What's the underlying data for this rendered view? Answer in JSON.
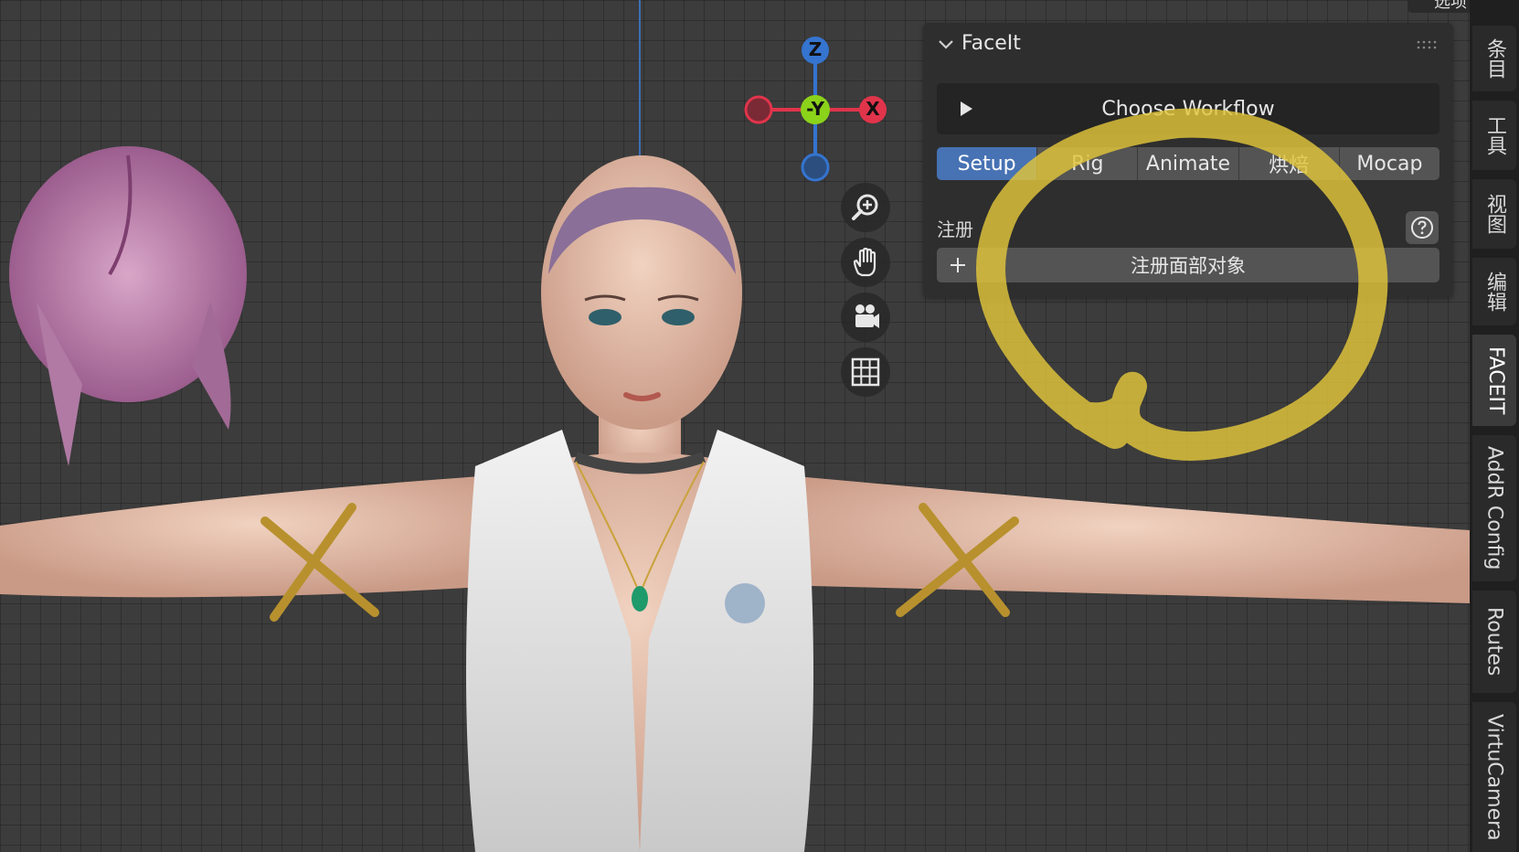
{
  "top_corner": {
    "label": "选项"
  },
  "panel": {
    "title": "FaceIt",
    "collapse_icon": "chevron-down-icon",
    "workflow_button": {
      "label": "Choose Workflow",
      "icon": "play-icon"
    },
    "tabs": [
      {
        "label": "Setup",
        "active": true
      },
      {
        "label": "Rig",
        "active": false
      },
      {
        "label": "Animate",
        "active": false
      },
      {
        "label": "烘焙",
        "active": false
      },
      {
        "label": "Mocap",
        "active": false
      }
    ],
    "section": {
      "label": "注册",
      "help_icon": "question-icon"
    },
    "register_button": {
      "label": "注册面部对象",
      "icon": "plus-icon"
    }
  },
  "gizmo": {
    "z": "Z",
    "y": "-Y",
    "x": "X"
  },
  "viewport_tools": [
    "zoom-icon",
    "hand-icon",
    "camera-icon",
    "grid-icon"
  ],
  "sidebar_tabs": [
    {
      "label": "条目",
      "active": false
    },
    {
      "label": "工具",
      "active": false
    },
    {
      "label": "视图",
      "active": false
    },
    {
      "label": "编辑",
      "active": false
    },
    {
      "label": "FACEIT",
      "active": true
    },
    {
      "label": "AddR Config",
      "active": false
    },
    {
      "label": "Routes",
      "active": false
    },
    {
      "label": "VirtuCamera",
      "active": false
    }
  ],
  "colors": {
    "accent": "#4772b3",
    "annotation": "#e2c63a",
    "axis_x": "#e0344b",
    "axis_y": "#8bd21b",
    "axis_z": "#3574cf"
  }
}
